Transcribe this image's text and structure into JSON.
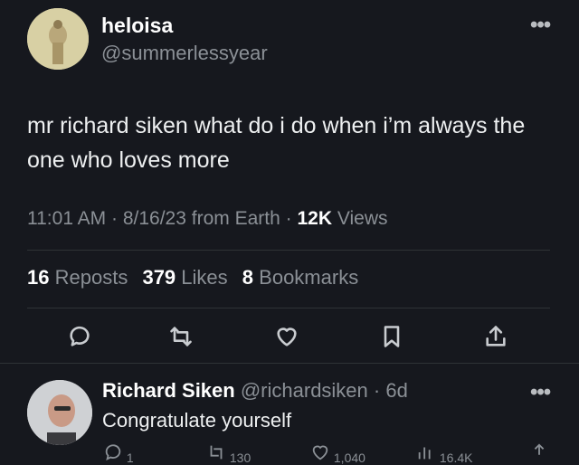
{
  "tweet": {
    "author_name": "heloisa",
    "author_handle": "@summerlessyear",
    "text": "mr richard siken what do i do when i’m always the one who loves more",
    "time": "11:01 AM",
    "date": "8/16/23",
    "source": "from Earth",
    "views_count": "12K",
    "views_label": "Views",
    "more_icon": "more-horizontal-icon"
  },
  "stats": {
    "reposts_count": "16",
    "reposts_label": "Reposts",
    "likes_count": "379",
    "likes_label": "Likes",
    "bookmarks_count": "8",
    "bookmarks_label": "Bookmarks"
  },
  "actions": [
    "reply-icon",
    "repost-icon",
    "like-icon",
    "bookmark-icon",
    "share-icon"
  ],
  "reply": {
    "author_name": "Richard Siken",
    "author_handle": "@richardsiken",
    "age": "6d",
    "text": "Congratulate yourself",
    "reply_count": "1",
    "repost_count": "130",
    "like_count": "1,040",
    "views_count": "16.4K"
  },
  "colors": {
    "background": "#16181e",
    "text_primary": "#e7e9ea",
    "text_secondary": "#8b9096",
    "divider": "#2f3336"
  }
}
